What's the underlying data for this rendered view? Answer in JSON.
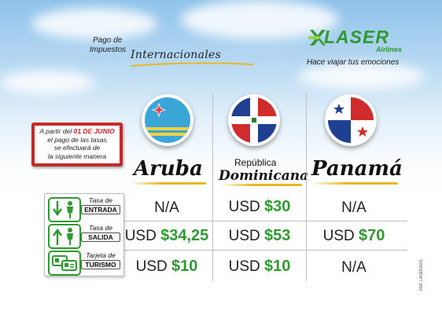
{
  "header": {
    "title_line1": "Pago de",
    "title_line2": "Impuestos",
    "title_big": "Internacionales"
  },
  "logo": {
    "name": "LASER",
    "sub": "Airlines",
    "slogan": "Hace viajar tus emociones",
    "brand_color": "#2e9a2f"
  },
  "notice": {
    "prefix": "A partir del ",
    "date": "01 DE JUNIO",
    "line2": "el pago de las tasas",
    "line3": "se efectuará de",
    "line4": "la siguiente manera",
    "accent_color": "#c52a2a"
  },
  "countries": [
    {
      "name": "Aruba",
      "flag_icon": "aruba-flag-icon"
    },
    {
      "name_line1": "República",
      "name_line2": "Dominicana",
      "flag_icon": "dominican-republic-flag-icon"
    },
    {
      "name": "Panamá",
      "flag_icon": "panama-flag-icon"
    }
  ],
  "rows": [
    {
      "label_top": "Tasa de",
      "label_box": "ENTRADA",
      "icon": "entry-arrow-person-icon"
    },
    {
      "label_top": "Tasa de",
      "label_box": "SALIDA",
      "icon": "exit-arrow-person-icon"
    },
    {
      "label_top": "Tarjeta de",
      "label_box": "TURISMO",
      "icon": "tourist-card-icon"
    }
  ],
  "table": {
    "entrada": {
      "aruba": {
        "text": "N/A"
      },
      "dominicana": {
        "currency": "USD",
        "amount": "$30"
      },
      "panama": {
        "text": "N/A"
      }
    },
    "salida": {
      "aruba": {
        "currency": "USD",
        "amount": "$34,25"
      },
      "dominicana": {
        "currency": "USD",
        "amount": "$53"
      },
      "panama": {
        "currency": "USD",
        "amount": "$70"
      }
    },
    "turismo": {
      "aruba": {
        "currency": "USD",
        "amount": "$10"
      },
      "dominicana": {
        "currency": "USD",
        "amount": "$10"
      },
      "panama": {
        "text": "N/A"
      }
    }
  },
  "footer_code": "REF. LASER0001"
}
